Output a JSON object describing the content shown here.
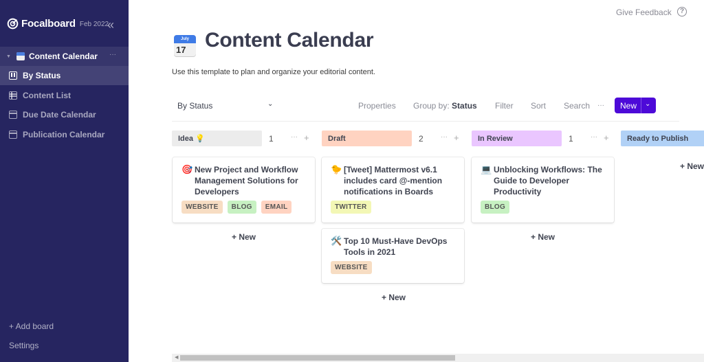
{
  "sidebar": {
    "brand": "Focalboard",
    "version": "Feb 2022",
    "collapse_icon": "double-chevron-left-icon",
    "board": {
      "title": "Content Calendar",
      "icon": "calendar-emoji"
    },
    "views": [
      {
        "label": "By Status",
        "icon": "board-icon",
        "active": true
      },
      {
        "label": "Content List",
        "icon": "table-icon",
        "active": false
      },
      {
        "label": "Due Date Calendar",
        "icon": "calendar-icon",
        "active": false
      },
      {
        "label": "Publication Calendar",
        "icon": "calendar-icon",
        "active": false
      }
    ],
    "add_board": "+ Add board",
    "settings": "Settings"
  },
  "topbar": {
    "feedback": "Give Feedback",
    "help": "?"
  },
  "header": {
    "icon_month": "July",
    "icon_day": "17",
    "title": "Content Calendar",
    "description": "Use this template to plan and organize your editorial content."
  },
  "viewbar": {
    "view_name": "By Status",
    "properties": "Properties",
    "group_by_label": "Group by:",
    "group_by_value": "Status",
    "filter": "Filter",
    "sort": "Sort",
    "search": "Search",
    "more": "···",
    "new": "New"
  },
  "columns": [
    {
      "label": "Idea 💡",
      "count": "1",
      "color": "#ececec",
      "cards": [
        {
          "icon": "🎯",
          "title": "New Project and Workflow Management Solutions for Developers",
          "tags": [
            {
              "label": "WEBSITE",
              "color": "#f7ddc3"
            },
            {
              "label": "BLOG",
              "color": "#c7f1c2"
            },
            {
              "label": "EMAIL",
              "color": "#ffd3c1"
            }
          ]
        }
      ]
    },
    {
      "label": "Draft",
      "count": "2",
      "color": "#ffd3c1",
      "cards": [
        {
          "icon": "🐤",
          "title": "[Tweet] Mattermost v6.1 includes card @-mention notifications in Boards",
          "tags": [
            {
              "label": "TWITTER",
              "color": "#f3f7b5"
            }
          ]
        },
        {
          "icon": "🛠️",
          "title": "Top 10 Must-Have DevOps Tools in 2021",
          "tags": [
            {
              "label": "WEBSITE",
              "color": "#f7ddc3"
            }
          ]
        }
      ]
    },
    {
      "label": "In Review",
      "count": "1",
      "color": "#eac6ff",
      "cards": [
        {
          "icon": "💻",
          "title": "Unblocking Workflows: The Guide to Developer Productivity",
          "tags": [
            {
              "label": "BLOG",
              "color": "#c7f1c2"
            }
          ]
        }
      ]
    },
    {
      "label": "Ready to Publish",
      "count": "",
      "color": "#b1d1f6",
      "cards": []
    }
  ],
  "add_new_label": "+ New"
}
